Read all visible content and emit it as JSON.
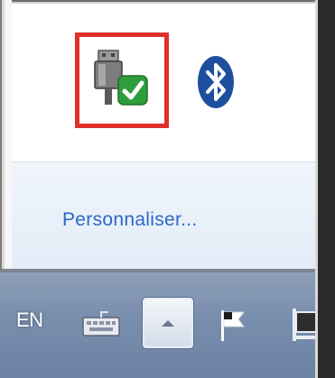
{
  "popup": {
    "customize_link": "Personnaliser..."
  },
  "tray_icons": [
    {
      "name": "usb-safely-remove-icon",
      "highlighted": true
    },
    {
      "name": "bluetooth-icon",
      "highlighted": false
    }
  ],
  "taskbar": {
    "language": "EN",
    "icons": [
      "keyboard-icon",
      "show-hidden-icons-arrow-icon",
      "action-center-flag-icon",
      "network-icon"
    ]
  },
  "colors": {
    "highlight": "#e0302a",
    "link": "#2a68c7",
    "taskbar": "#7a8fae"
  }
}
